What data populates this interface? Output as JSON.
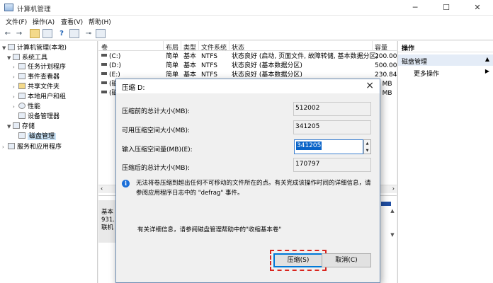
{
  "window": {
    "title": "计算机管理",
    "minimize": "─",
    "maximize": "☐",
    "close": "✕"
  },
  "menu": [
    "文件(F)",
    "操作(A)",
    "查看(V)",
    "帮助(H)"
  ],
  "tree": [
    {
      "label": "计算机管理(本地)",
      "level": 0,
      "twisty": "▼"
    },
    {
      "label": "系统工具",
      "level": 1,
      "twisty": "▼"
    },
    {
      "label": "任务计划程序",
      "level": 2,
      "twisty": "›"
    },
    {
      "label": "事件查看器",
      "level": 2,
      "twisty": "›"
    },
    {
      "label": "共享文件夹",
      "level": 2,
      "twisty": "›"
    },
    {
      "label": "本地用户和组",
      "level": 2,
      "twisty": "›"
    },
    {
      "label": "性能",
      "level": 2,
      "twisty": "›"
    },
    {
      "label": "设备管理器",
      "level": 2,
      "twisty": ""
    },
    {
      "label": "存储",
      "level": 1,
      "twisty": "▼"
    },
    {
      "label": "磁盘管理",
      "level": 2,
      "twisty": "",
      "selected": true
    },
    {
      "label": "服务和应用程序",
      "level": 1,
      "twisty": "›"
    }
  ],
  "volumes": {
    "headers": [
      "卷",
      "布局",
      "类型",
      "文件系统",
      "状态",
      "容量"
    ],
    "rows": [
      {
        "vol": "(C:)",
        "layout": "简单",
        "type": "基本",
        "fs": "NTFS",
        "status": "状态良好 (启动, 页面文件, 故障转储, 基本数据分区)",
        "cap": "200.00"
      },
      {
        "vol": "(D:)",
        "layout": "简单",
        "type": "基本",
        "fs": "NTFS",
        "status": "状态良好 (基本数据分区)",
        "cap": "500.00"
      },
      {
        "vol": "(E:)",
        "layout": "简单",
        "type": "基本",
        "fs": "NTFS",
        "status": "状态良好 (基本数据分区)",
        "cap": "230.84"
      },
      {
        "vol": "(磁",
        "layout": "",
        "type": "",
        "fs": "",
        "status": "",
        "cap": "0 MB"
      },
      {
        "vol": "(磁",
        "layout": "",
        "type": "",
        "fs": "",
        "status": "",
        "cap": "0 MB"
      }
    ]
  },
  "disk": {
    "lines": [
      "基本",
      "931.",
      "联机"
    ]
  },
  "actions": {
    "header": "操作",
    "section": "磁盘管理",
    "more": "更多操作"
  },
  "dialog": {
    "title": "压缩 D:",
    "total_label": "压缩前的总计大小(MB):",
    "total_value": "512002",
    "available_label": "可用压缩空间大小(MB):",
    "available_value": "341205",
    "input_label": "输入压缩空间量(MB)(E):",
    "input_value": "341205",
    "after_label": "压缩后的总计大小(MB):",
    "after_value": "170797",
    "info_line1": "无法将卷压缩到超出任何不可移动的文件所在的点。有关完成该操作时间的详细信息，请",
    "info_line2": "参阅应用程序日志中的 \"defrag\" 事件。",
    "help": "有关详细信息，请参阅磁盘管理帮助中的\"收缩基本卷\"",
    "ok_button": "压缩(S)",
    "cancel_button": "取消(C)"
  }
}
